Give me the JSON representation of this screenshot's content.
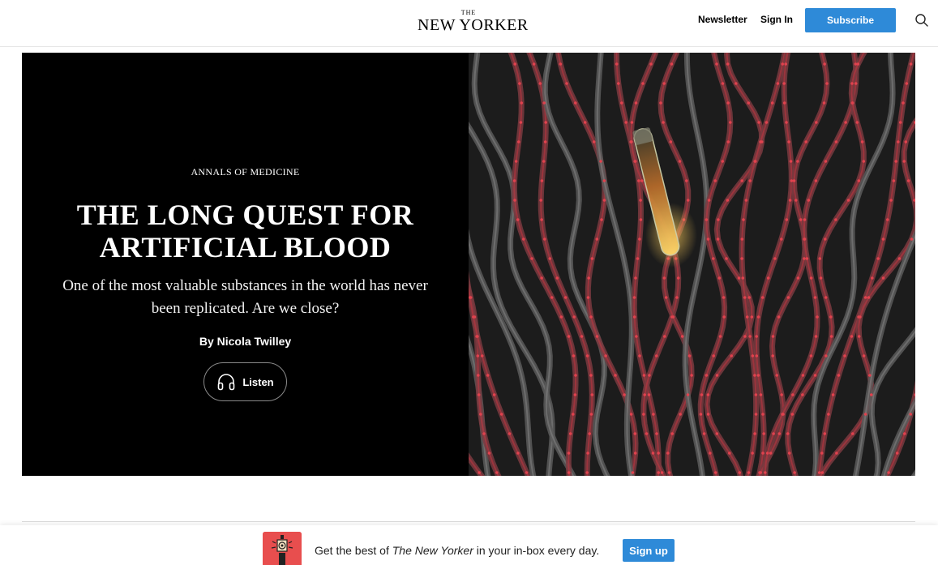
{
  "header": {
    "logo_the": "THE",
    "logo_main": "NEW YORKER",
    "newsletter_link": "Newsletter",
    "signin_link": "Sign In",
    "subscribe_button": "Subscribe",
    "search_icon": "search-icon"
  },
  "hero": {
    "rubric": "ANNALS OF MEDICINE",
    "headline": "THE LONG QUEST FOR ARTIFICIAL BLOOD",
    "dek": "One of the most valuable substances in the world has never been replicated. Are we close?",
    "byline": "By Nicola Twilley",
    "listen_label": "Listen",
    "listen_icon": "headphones-icon",
    "art_description_icon": "illustration-blood-vessels"
  },
  "newsletter_bar": {
    "text_before": "Get the best of ",
    "text_italic": "The New Yorker",
    "text_after": " in your in-box every day.",
    "signup_button": "Sign up",
    "illustration_icon": "newsletter-illustration-icon"
  },
  "colors": {
    "accent": "#2e8ad8",
    "hero_background": "#000000",
    "vessel_red": "#c9343f",
    "vessel_gray": "#8a8a8a",
    "glow": "#f5b23a"
  }
}
